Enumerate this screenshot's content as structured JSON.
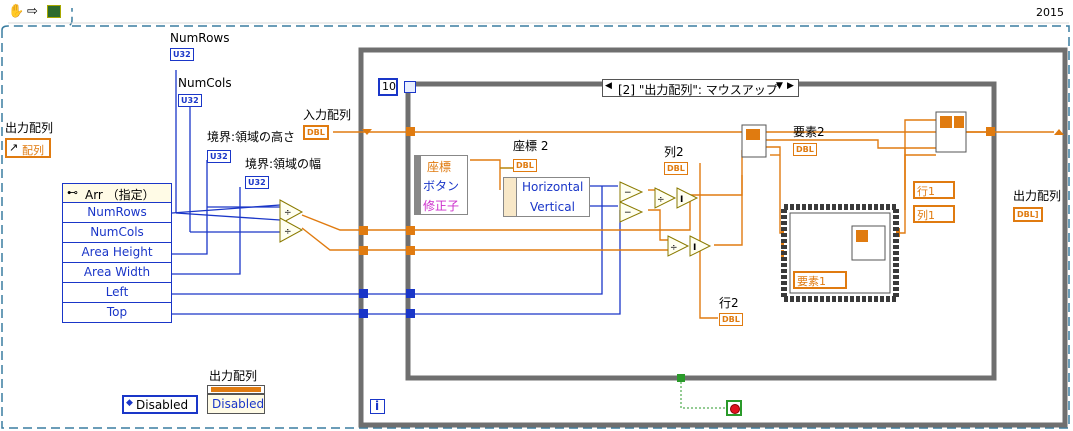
{
  "toolbar": {
    "year": "2015"
  },
  "labels": {
    "output_array_left": "出力配列",
    "array_control": "配列",
    "num_rows": "NumRows",
    "num_cols": "NumCols",
    "area_height_label": "境界:領域の高さ",
    "area_width_label": "境界:領域の幅",
    "input_array": "入力配列",
    "coord2": "座標 2",
    "col2": "列2",
    "element2": "要素2",
    "row2": "行2",
    "output_array_right": "出力配列",
    "output_array_bottom": "出力配列"
  },
  "terminals": {
    "u32": "U32",
    "dbl": "DBL",
    "dbl_array": "DBL]"
  },
  "unbundle": {
    "header": "Arr （指定）",
    "rows": [
      "NumRows",
      "NumCols",
      "Area Height",
      "Area Width",
      "Left",
      "Top"
    ]
  },
  "event_structure": {
    "loop_count": "10",
    "selector": "[2] \"出力配列\": マウスアップ",
    "info_icon": "i"
  },
  "event_data": {
    "rows": [
      "座標",
      "ボタン",
      "修正子"
    ],
    "coord_rows": [
      "Horizontal",
      "Vertical"
    ]
  },
  "constants": {
    "row1": "行1",
    "col1": "列1",
    "element1": "要素1"
  },
  "disabled": {
    "enum_value": "Disabled",
    "prop_value": "Disabled"
  },
  "colors": {
    "blue_wire": "#1a36c8",
    "orange_wire": "#e07b10",
    "frame_gray": "#6f6f6f",
    "stop_red": "#e0121f"
  }
}
